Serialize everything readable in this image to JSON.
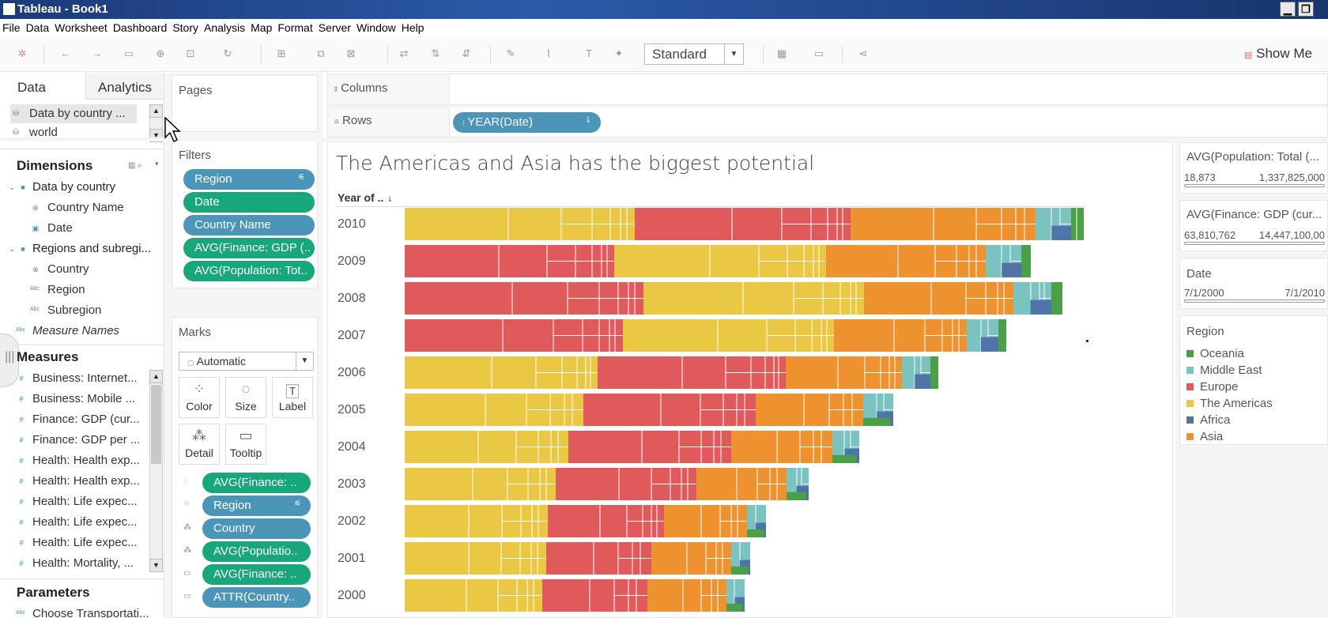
{
  "window": {
    "title": "Tableau - Book1",
    "min": "▁",
    "restore": "❐"
  },
  "menu": [
    "File",
    "Data",
    "Worksheet",
    "Dashboard",
    "Story",
    "Analysis",
    "Map",
    "Format",
    "Server",
    "Window",
    "Help"
  ],
  "toolbar": {
    "mark_type": "Standard",
    "show_me": "Show Me"
  },
  "left": {
    "tabs": {
      "data": "Data",
      "analytics": "Analytics"
    },
    "sources": [
      "Data by country ...",
      "world"
    ],
    "dimensions_header": "Dimensions",
    "dimensions": [
      {
        "label": "Data by country",
        "type": "table"
      },
      {
        "label": "Country Name",
        "type": "geo"
      },
      {
        "label": "Date",
        "type": "date"
      },
      {
        "label": "Regions and subregi...",
        "type": "table"
      },
      {
        "label": "Country",
        "type": "geo"
      },
      {
        "label": "Region",
        "type": "abc"
      },
      {
        "label": "Subregion",
        "type": "abc"
      },
      {
        "label": "Measure Names",
        "type": "abc"
      }
    ],
    "measures_header": "Measures",
    "measures": [
      "Business: Internet...",
      "Business: Mobile ...",
      "Finance: GDP (cur...",
      "Finance: GDP per ...",
      "Health: Health exp...",
      "Health: Health exp...",
      "Health: Life expec...",
      "Health: Life expec...",
      "Health: Life expec...",
      "Health: Mortality, ..."
    ],
    "parameters_header": "Parameters",
    "parameters": [
      "Choose Transportati..."
    ]
  },
  "pages": {
    "title": "Pages"
  },
  "filters": {
    "title": "Filters",
    "items": [
      {
        "label": "Region",
        "kind": "blue"
      },
      {
        "label": "Date",
        "kind": "green"
      },
      {
        "label": "Country Name",
        "kind": "blue"
      },
      {
        "label": "AVG(Finance: GDP (..",
        "kind": "green"
      },
      {
        "label": "AVG(Population: Tot..",
        "kind": "green"
      }
    ]
  },
  "marks": {
    "title": "Marks",
    "type": "Automatic",
    "buttons": [
      "Color",
      "Size",
      "Label",
      "Detail",
      "Tooltip"
    ],
    "fields": [
      {
        "label": "AVG(Finance: ..",
        "kind": "green"
      },
      {
        "label": "Region",
        "kind": "blue"
      },
      {
        "label": "Country",
        "kind": "blue"
      },
      {
        "label": "AVG(Populatio..",
        "kind": "green"
      },
      {
        "label": "AVG(Finance: ..",
        "kind": "green"
      },
      {
        "label": "ATTR(Country..",
        "kind": "blue"
      }
    ]
  },
  "shelves": {
    "columns": "Columns",
    "rows": "Rows",
    "rows_pill": "YEAR(Date)"
  },
  "sheet": {
    "title": "The Americas and Asia has the biggest potential",
    "header": "Year of .."
  },
  "colors": {
    "Oceania": "#4a9f47",
    "Middle East": "#7bc3c0",
    "Europe": "#e05a5c",
    "The Americas": "#ebc843",
    "Africa": "#4e74a9",
    "Asia": "#ee9230"
  },
  "chart_data": {
    "type": "bar",
    "orientation": "horizontal",
    "stacked": true,
    "title": "The Americas and Asia has the biggest potential",
    "categories": [
      "2010",
      "2009",
      "2008",
      "2007",
      "2006",
      "2005",
      "2004",
      "2003",
      "2002",
      "2001",
      "2000"
    ],
    "segments_note": "relative widths per region in stacking order",
    "rows": [
      {
        "year": "2010",
        "segments": [
          [
            "The Americas",
            291
          ],
          [
            "Europe",
            273
          ],
          [
            "Asia",
            234
          ],
          [
            "Middle East",
            45
          ],
          [
            "Oceania",
            16
          ]
        ]
      },
      {
        "year": "2009",
        "segments": [
          [
            "Europe",
            265
          ],
          [
            "The Americas",
            268
          ],
          [
            "Asia",
            202
          ],
          [
            "Middle East",
            45
          ],
          [
            "Oceania",
            12
          ]
        ]
      },
      {
        "year": "2008",
        "segments": [
          [
            "Europe",
            302
          ],
          [
            "The Americas",
            279
          ],
          [
            "Asia",
            189
          ],
          [
            "Middle East",
            48
          ],
          [
            "Oceania",
            14
          ]
        ]
      },
      {
        "year": "2007",
        "segments": [
          [
            "Europe",
            276
          ],
          [
            "The Americas",
            267
          ],
          [
            "Asia",
            168
          ],
          [
            "Middle East",
            40
          ],
          [
            "Oceania",
            10
          ]
        ]
      },
      {
        "year": "2006",
        "segments": [
          [
            "The Americas",
            244
          ],
          [
            "Europe",
            238
          ],
          [
            "Asia",
            147
          ],
          [
            "Middle East",
            36
          ],
          [
            "Oceania",
            10
          ]
        ]
      },
      {
        "year": "2005",
        "segments": [
          [
            "The Americas",
            226
          ],
          [
            "Europe",
            218
          ],
          [
            "Asia",
            136
          ],
          [
            "Middle East",
            38
          ]
        ]
      },
      {
        "year": "2004",
        "segments": [
          [
            "The Americas",
            207
          ],
          [
            "Europe",
            206
          ],
          [
            "Asia",
            128
          ],
          [
            "Middle East",
            34
          ]
        ]
      },
      {
        "year": "2003",
        "segments": [
          [
            "The Americas",
            191
          ],
          [
            "Europe",
            178
          ],
          [
            "Asia",
            114
          ],
          [
            "Middle East",
            28
          ]
        ]
      },
      {
        "year": "2002",
        "segments": [
          [
            "The Americas",
            181
          ],
          [
            "Europe",
            147
          ],
          [
            "Asia",
            105
          ],
          [
            "Middle East",
            24
          ]
        ]
      },
      {
        "year": "2001",
        "segments": [
          [
            "The Americas",
            179
          ],
          [
            "Europe",
            133
          ],
          [
            "Asia",
            101
          ],
          [
            "Middle East",
            24
          ]
        ]
      },
      {
        "year": "2000",
        "segments": [
          [
            "The Americas",
            174
          ],
          [
            "Europe",
            133
          ],
          [
            "Asia",
            100
          ],
          [
            "Middle East",
            23
          ]
        ]
      }
    ]
  },
  "right": {
    "pop": {
      "title": "AVG(Population: Total (...",
      "min": "18,873",
      "max": "1,337,825,000"
    },
    "gdp": {
      "title": "AVG(Finance: GDP (cur...",
      "min": "63,810,762",
      "max": "14,447,100,00"
    },
    "date": {
      "title": "Date",
      "min": "7/1/2000",
      "max": "7/1/2010"
    },
    "region": {
      "title": "Region",
      "items": [
        "Oceania",
        "Middle East",
        "Europe",
        "The Americas",
        "Africa",
        "Asia"
      ]
    }
  }
}
